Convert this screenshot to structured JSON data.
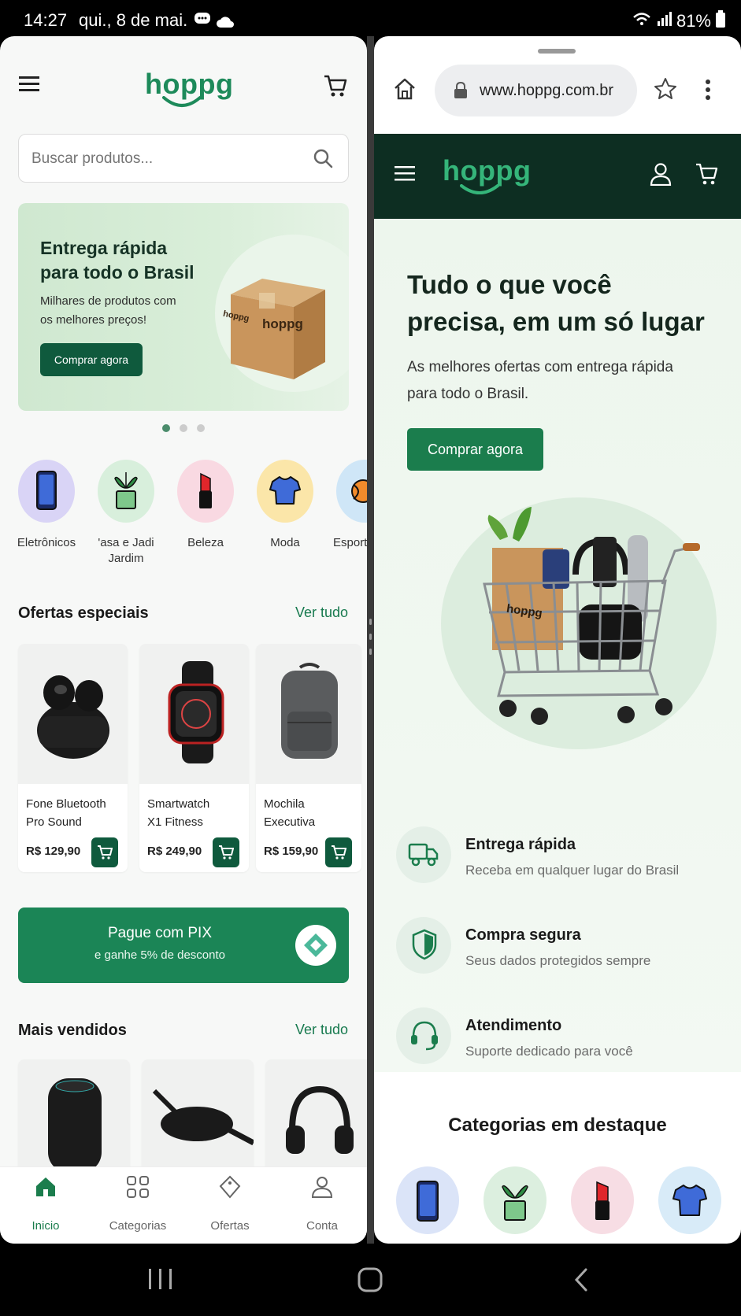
{
  "status_bar": {
    "time": "14:27",
    "date": "qui., 8 de mai.",
    "battery": "81%"
  },
  "left_app": {
    "logo": "hoppg",
    "search_placeholder": "Buscar produtos...",
    "banner": {
      "title_line1": "Entrega rápida",
      "title_line2": "para todo o Brasil",
      "subtitle_line1": "Milhares de produtos com",
      "subtitle_line2": "os melhores preços!",
      "button": "Comprar agora",
      "box_label": "hoppg"
    },
    "categories": [
      {
        "label": "Eletrônicos",
        "color": "#d9d4f6"
      },
      {
        "label_line1": "'asa e Jadi",
        "label_line2": "Jardim",
        "color": "#d8efdc"
      },
      {
        "label": "Beleza",
        "color": "#f9d9e2"
      },
      {
        "label": "Moda",
        "color": "#fbe6a9"
      },
      {
        "label": "Esport",
        "color": "#cfe6f7"
      }
    ],
    "offers": {
      "title": "Ofertas especiais",
      "see_all": "Ver tudo",
      "products": [
        {
          "name_line1": "Fone Bluetooth",
          "name_line2": "Pro Sound",
          "price": "R$ 129,90"
        },
        {
          "name_line1": "Smartwatch",
          "name_line2": "X1 Fitness",
          "price": "R$ 249,90"
        },
        {
          "name_line1": "Mochila",
          "name_line2": "Executiva",
          "price": "R$ 159,90"
        }
      ]
    },
    "pix": {
      "title": "Pague com PIX",
      "subtitle": "e ganhe 5% de desconto"
    },
    "bestsellers": {
      "title": "Mais vendidos",
      "see_all": "Ver tudo"
    },
    "nav": [
      {
        "label": "Inicio"
      },
      {
        "label": "Categorias"
      },
      {
        "label": "Ofertas"
      },
      {
        "label": "Conta"
      }
    ]
  },
  "browser": {
    "url": "www.hoppg.com.br",
    "site_logo": "hoppg",
    "hero": {
      "title_line1": "Tudo o que você",
      "title_line2": "precisa, em um só lugar",
      "subtitle_line1": "As melhores ofertas com entrega rápida",
      "subtitle_line2": "para todo o Brasil.",
      "button": "Comprar agora",
      "bag_label": "hoppg"
    },
    "features": [
      {
        "title": "Entrega rápida",
        "desc": "Receba em qualquer lugar do Brasil"
      },
      {
        "title": "Compra segura",
        "desc": "Seus dados protegidos sempre"
      },
      {
        "title": "Atendimento",
        "desc": "Suporte dedicado para você"
      }
    ],
    "categories_title": "Categorias em destaque"
  },
  "colors": {
    "brand_green": "#1d8a5a",
    "dark_green": "#0f5a3d",
    "header_dark": "#0d2e22"
  }
}
